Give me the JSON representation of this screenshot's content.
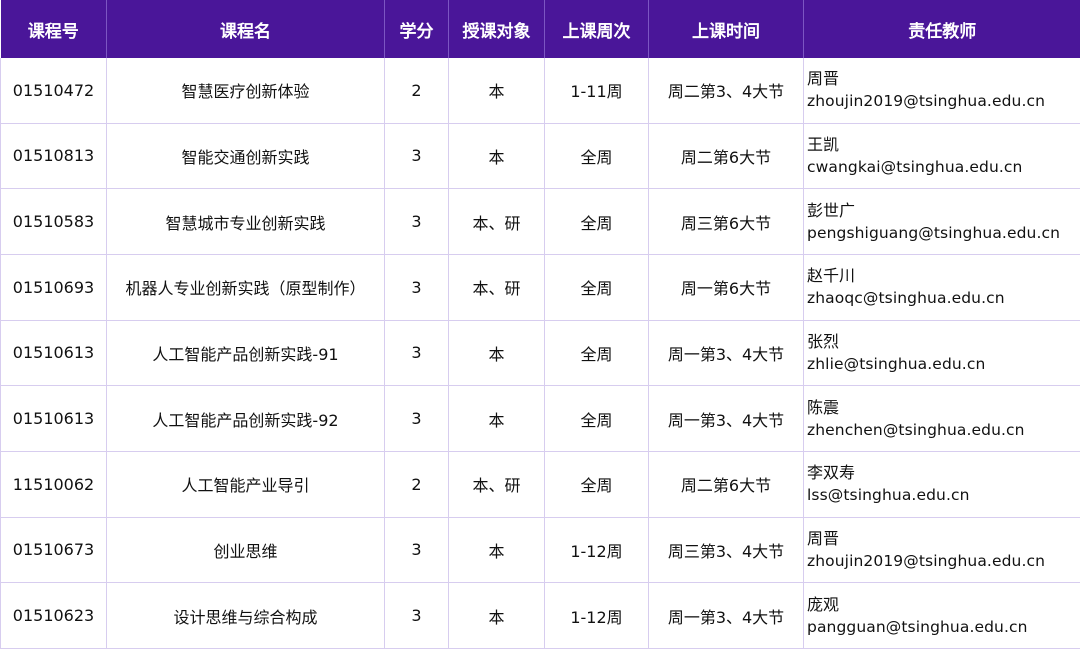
{
  "table": {
    "headers": [
      "课程号",
      "课程名",
      "学分",
      "授课对象",
      "上课周次",
      "上课时间",
      "责任教师"
    ],
    "rows": [
      {
        "code": "01510472",
        "name": "智慧医疗创新体验",
        "credit": "2",
        "audience": "本",
        "weeks": "1-11周",
        "time": "周二第3、4大节",
        "teacher": "周晋",
        "email": "zhoujin2019@tsinghua.edu.cn"
      },
      {
        "code": "01510813",
        "name": "智能交通创新实践",
        "credit": "3",
        "audience": "本",
        "weeks": "全周",
        "time": "周二第6大节",
        "teacher": "王凯",
        "email": "cwangkai@tsinghua.edu.cn"
      },
      {
        "code": "01510583",
        "name": "智慧城市专业创新实践",
        "credit": "3",
        "audience": "本、研",
        "weeks": "全周",
        "time": "周三第6大节",
        "teacher": "彭世广",
        "email": "pengshiguang@tsinghua.edu.cn"
      },
      {
        "code": "01510693",
        "name": "机器人专业创新实践（原型制作）",
        "credit": "3",
        "audience": "本、研",
        "weeks": "全周",
        "time": "周一第6大节",
        "teacher": "赵千川",
        "email": "zhaoqc@tsinghua.edu.cn"
      },
      {
        "code": "01510613",
        "name": "人工智能产品创新实践-91",
        "credit": "3",
        "audience": "本",
        "weeks": "全周",
        "time": "周一第3、4大节",
        "teacher": "张烈",
        "email": "zhlie@tsinghua.edu.cn"
      },
      {
        "code": "01510613",
        "name": "人工智能产品创新实践-92",
        "credit": "3",
        "audience": "本",
        "weeks": "全周",
        "time": "周一第3、4大节",
        "teacher": "陈震",
        "email": "zhenchen@tsinghua.edu.cn"
      },
      {
        "code": "11510062",
        "name": "人工智能产业导引",
        "credit": "2",
        "audience": "本、研",
        "weeks": "全周",
        "time": "周二第6大节",
        "teacher": "李双寿",
        "email": "lss@tsinghua.edu.cn"
      },
      {
        "code": "01510673",
        "name": "创业思维",
        "credit": "3",
        "audience": "本",
        "weeks": "1-12周",
        "time": "周三第3、4大节",
        "teacher": "周晋",
        "email": "zhoujin2019@tsinghua.edu.cn"
      },
      {
        "code": "01510623",
        "name": "设计思维与综合构成",
        "credit": "3",
        "audience": "本",
        "weeks": "1-12周",
        "time": "周一第3、4大节",
        "teacher": "庞观",
        "email": "pangguan@tsinghua.edu.cn"
      }
    ]
  },
  "colors": {
    "header_bg": "#4a1699",
    "header_text": "#ffffff",
    "grid_line": "#d7cdef"
  }
}
